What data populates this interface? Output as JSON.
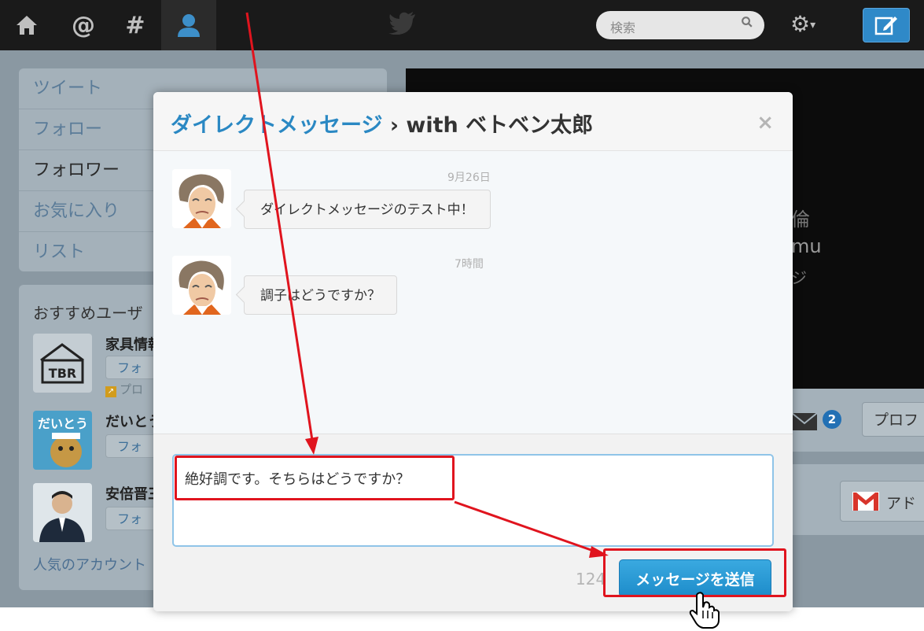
{
  "topbar": {
    "nav_icons": [
      "home-icon",
      "mentions-icon",
      "hashtag-icon",
      "profile-icon"
    ],
    "search_placeholder": "検索"
  },
  "left_menu": {
    "items": [
      {
        "label": "ツイート"
      },
      {
        "label": "フォロー"
      },
      {
        "label": "フォロワー"
      },
      {
        "label": "お気に入り"
      },
      {
        "label": "リスト"
      }
    ]
  },
  "recommend": {
    "heading": "おすすめユーザ",
    "users": [
      {
        "name": "家具情報",
        "avatar_text": "TBR",
        "follow_label": "フォ",
        "promo_label": "プロ"
      },
      {
        "name": "だいとう",
        "avatar_text": "だいとう",
        "follow_label": "フォ"
      },
      {
        "name": "安倍晋三",
        "follow_label": "フォ"
      }
    ],
    "popular_link": "人気のアカウント"
  },
  "profile": {
    "fragment_1": "倫",
    "fragment_2": "mu",
    "fragment_3": "ジ",
    "mail_count": "2",
    "profile_button": "プロフ",
    "gmail_button": "アド"
  },
  "modal": {
    "title_link": "ダイレクトメッセージ",
    "title_rest": " › with ベトベン太郎",
    "close": "×",
    "messages": [
      {
        "date": "9月26日",
        "text": "ダイレクトメッセージのテスト中！"
      },
      {
        "date": "7時間",
        "text": "調子はどうですか？"
      }
    ],
    "draft": "絶好調です。そちらはどうですか？",
    "char_count": "124",
    "send_label": "メッセージを送信"
  },
  "colors": {
    "accent": "#2a88c3",
    "send_button": "#1d8cca",
    "annotation": "#e0141e"
  }
}
